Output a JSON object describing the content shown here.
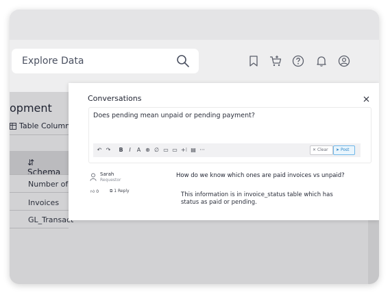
{
  "header": {
    "search_placeholder": "Explore Data",
    "icons": [
      "bookmark-icon",
      "cart-icon",
      "help-icon",
      "bell-icon",
      "user-icon"
    ]
  },
  "background": {
    "page_title_partial": "opment",
    "table_columns_label": "Table Columns",
    "schema_header": "Schema",
    "rows": [
      "Number of P",
      "Invoices",
      "GL_Transact"
    ]
  },
  "modal": {
    "title": "Conversations",
    "close_icon": "close-icon",
    "editor_text": "Does pending mean unpaid or pending payment?",
    "toolbar": {
      "tools": [
        "↶",
        "↷",
        "B",
        "I",
        "A",
        "⊕",
        "∅",
        "▭",
        "▭",
        "+⁝",
        "▤",
        "···"
      ],
      "clear_label": "Clear",
      "post_label": "Post"
    },
    "comment": {
      "user": "Sarah",
      "role": "Requestor",
      "likes": "0",
      "replies": "1 Reply",
      "question": "How do we know which ones are paid invoices vs unpaid?",
      "answer": "This information is in invoice_status table which has status as paid or pending."
    }
  }
}
